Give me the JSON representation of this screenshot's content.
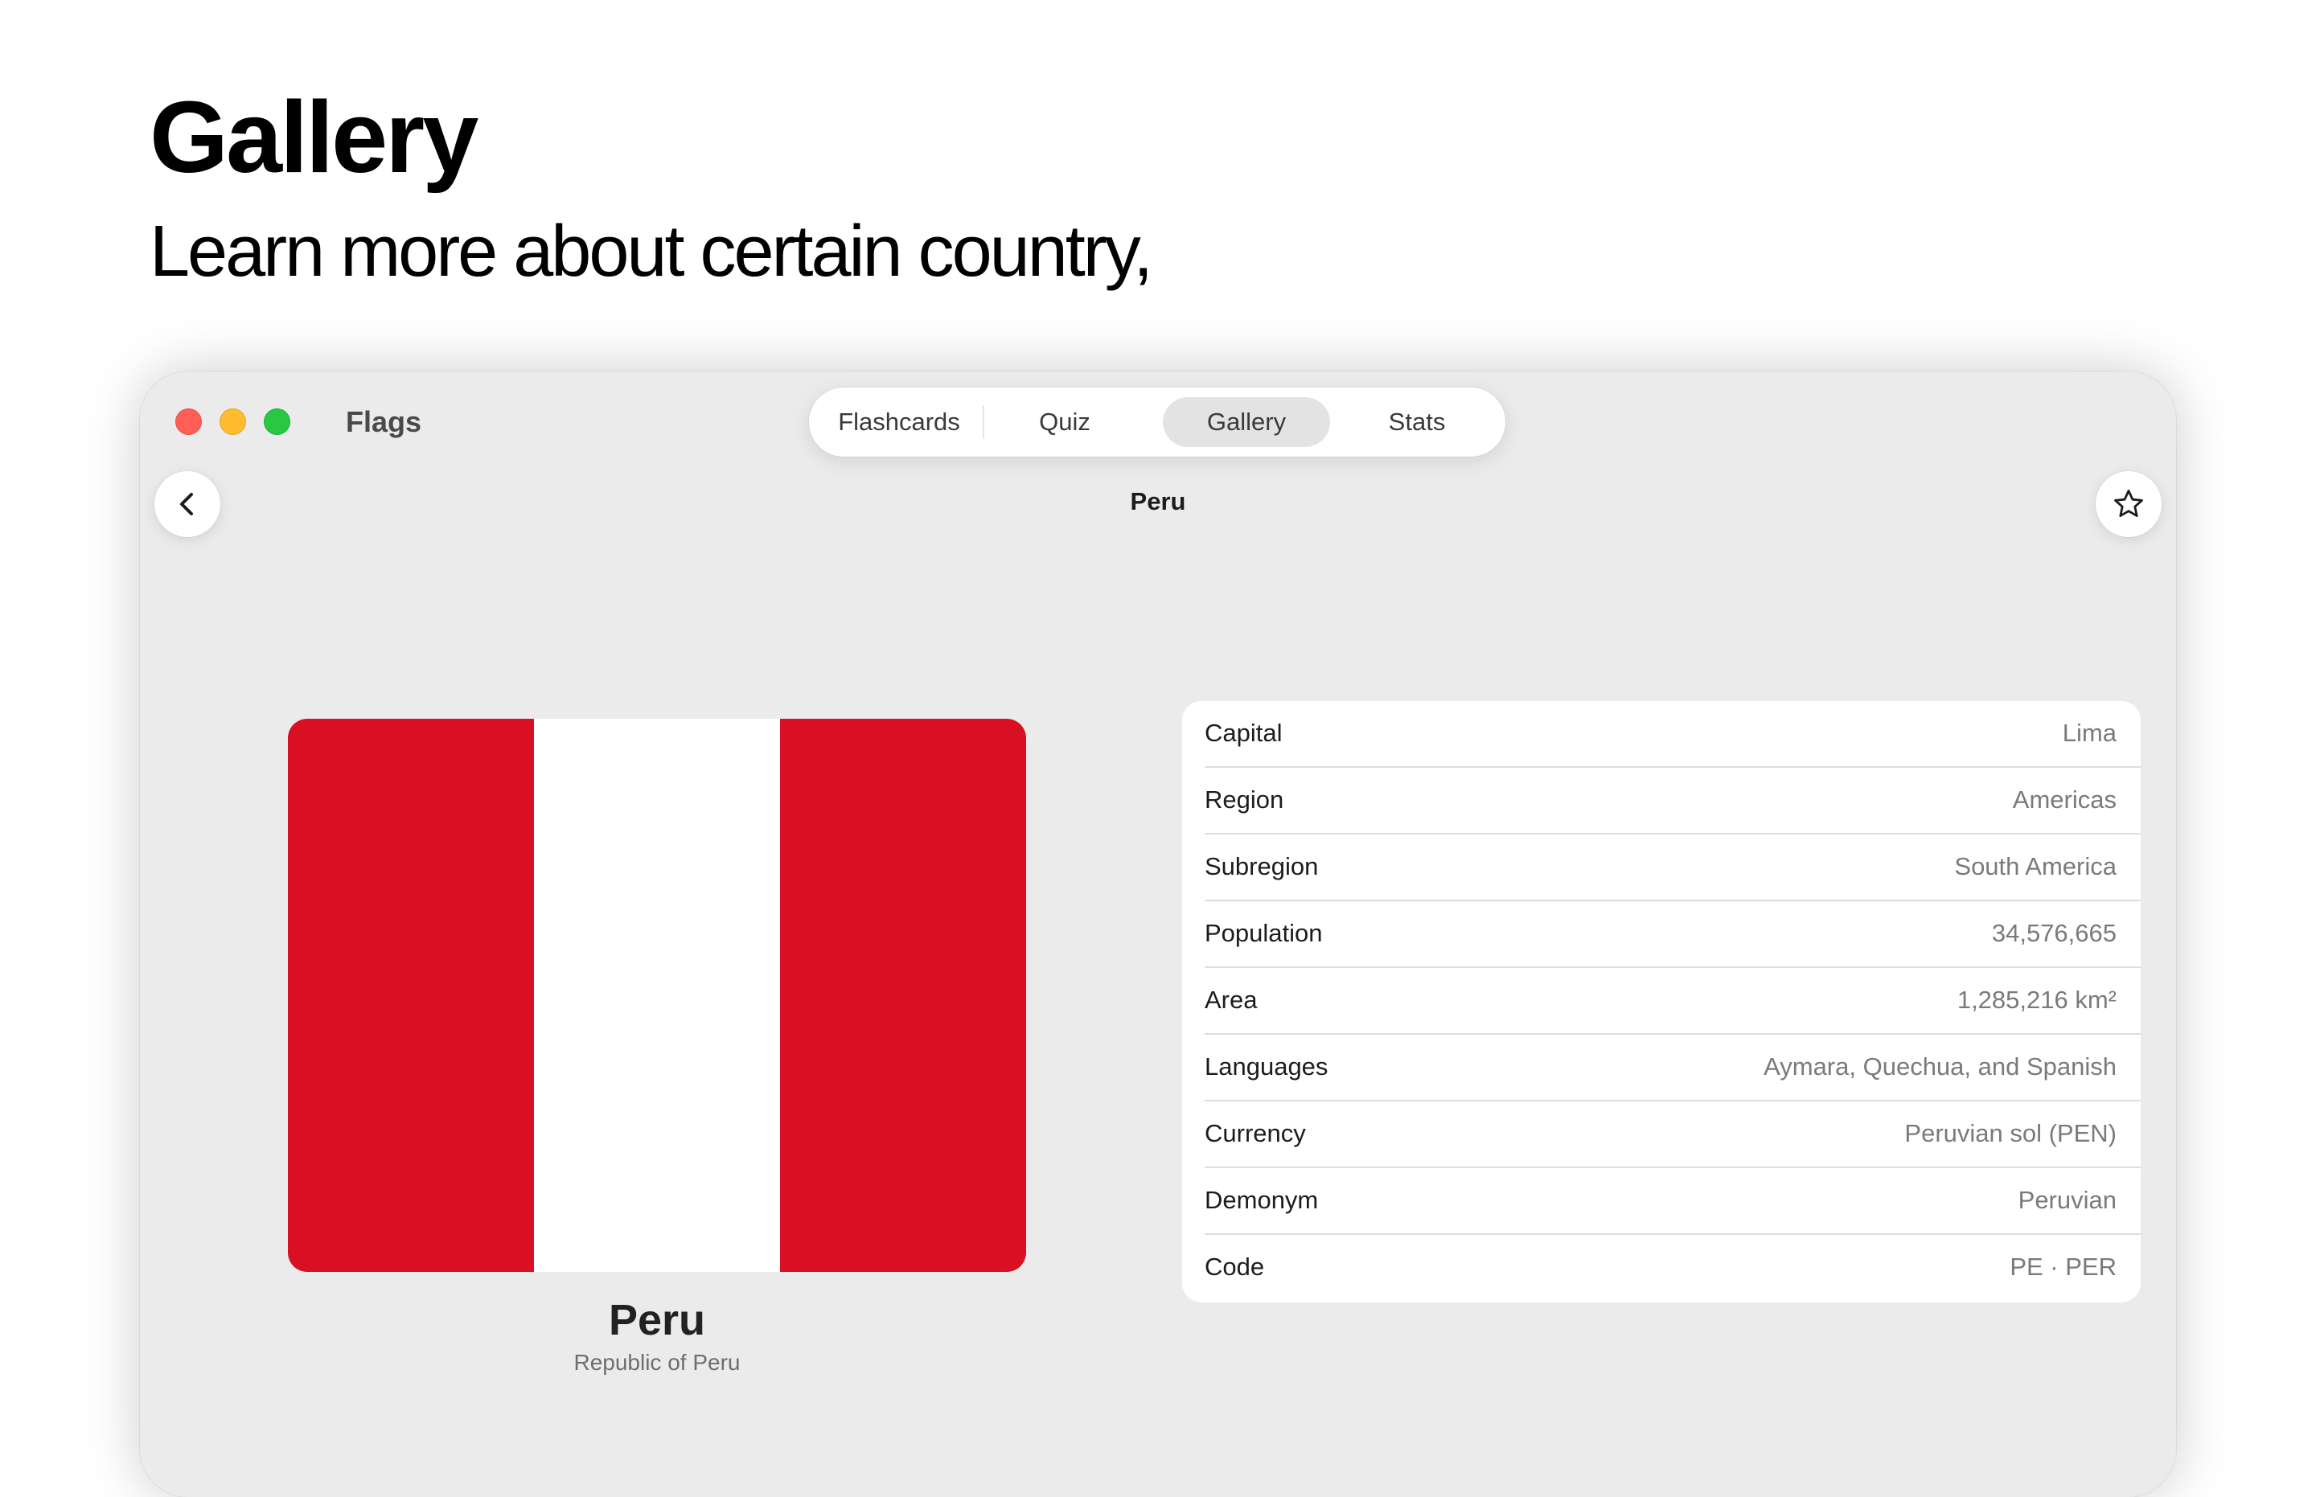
{
  "hero": {
    "title": "Gallery",
    "subtitle": "Learn more about certain country,"
  },
  "window": {
    "app_title": "Flags",
    "tabs": [
      {
        "label": "Flashcards",
        "active": false
      },
      {
        "label": "Quiz",
        "active": false
      },
      {
        "label": "Gallery",
        "active": true
      },
      {
        "label": "Stats",
        "active": false
      }
    ],
    "nav_title": "Peru",
    "back_icon": "chevron-left-icon",
    "favorite_icon": "star-icon"
  },
  "country": {
    "name": "Peru",
    "official_name": "Republic of Peru",
    "flag_colors": [
      "#d91023",
      "#ffffff",
      "#d91023"
    ]
  },
  "details": [
    {
      "label": "Capital",
      "value": "Lima"
    },
    {
      "label": "Region",
      "value": "Americas"
    },
    {
      "label": "Subregion",
      "value": "South America"
    },
    {
      "label": "Population",
      "value": "34,576,665"
    },
    {
      "label": "Area",
      "value": "1,285,216 km²"
    },
    {
      "label": "Languages",
      "value": "Aymara, Quechua, and Spanish"
    },
    {
      "label": "Currency",
      "value": "Peruvian sol (PEN)"
    },
    {
      "label": "Demonym",
      "value": "Peruvian"
    },
    {
      "label": "Code",
      "value": "PE · PER"
    }
  ]
}
